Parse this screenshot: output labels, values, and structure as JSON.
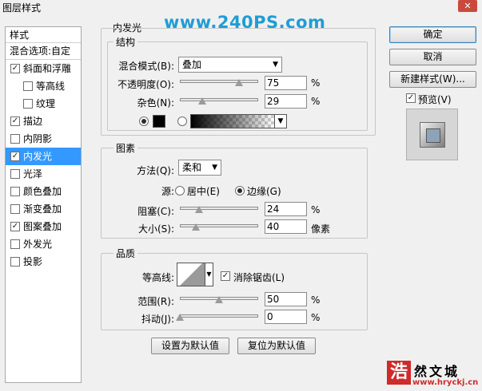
{
  "window": {
    "title": "图层样式",
    "close_glyph": "✕"
  },
  "watermark": "www.240PS.com",
  "style_list": {
    "header": "样式",
    "blend_options": "混合选项:自定",
    "items": [
      {
        "label": "斜面和浮雕",
        "checked": true,
        "indent": false,
        "selected": false
      },
      {
        "label": "等高线",
        "checked": false,
        "indent": true,
        "selected": false
      },
      {
        "label": "纹理",
        "checked": false,
        "indent": true,
        "selected": false
      },
      {
        "label": "描边",
        "checked": true,
        "indent": false,
        "selected": false
      },
      {
        "label": "内阴影",
        "checked": false,
        "indent": false,
        "selected": false
      },
      {
        "label": "内发光",
        "checked": true,
        "indent": false,
        "selected": true
      },
      {
        "label": "光泽",
        "checked": false,
        "indent": false,
        "selected": false
      },
      {
        "label": "颜色叠加",
        "checked": false,
        "indent": false,
        "selected": false
      },
      {
        "label": "渐变叠加",
        "checked": false,
        "indent": false,
        "selected": false
      },
      {
        "label": "图案叠加",
        "checked": true,
        "indent": false,
        "selected": false
      },
      {
        "label": "外发光",
        "checked": false,
        "indent": false,
        "selected": false
      },
      {
        "label": "投影",
        "checked": false,
        "indent": false,
        "selected": false
      }
    ]
  },
  "panel": {
    "title": "内发光",
    "structure": {
      "label": "结构",
      "blend_mode_label": "混合模式(B):",
      "blend_mode_value": "叠加",
      "opacity_label": "不透明度(O):",
      "opacity_value": "75",
      "opacity_unit": "%",
      "noise_label": "杂色(N):",
      "noise_value": "29",
      "noise_unit": "%",
      "glow_color": "#000000"
    },
    "elements": {
      "label": "图素",
      "method_label": "方法(Q):",
      "method_value": "柔和",
      "source_label": "源:",
      "source_center": "居中(E)",
      "source_edge": "边缘(G)",
      "choke_label": "阻塞(C):",
      "choke_value": "24",
      "choke_unit": "%",
      "size_label": "大小(S):",
      "size_value": "40",
      "size_unit": "像素"
    },
    "quality": {
      "label": "品质",
      "contour_label": "等高线:",
      "anti_alias_label": "消除锯齿(L)",
      "range_label": "范围(R):",
      "range_value": "50",
      "range_unit": "%",
      "jitter_label": "抖动(J):",
      "jitter_value": "0",
      "jitter_unit": "%"
    },
    "set_default": "设置为默认值",
    "reset_default": "复位为默认值"
  },
  "sliders": {
    "opacity": 0.75,
    "noise": 0.29,
    "choke": 0.24,
    "size": 0.2,
    "range": 0.5,
    "jitter": 0.0
  },
  "buttons": {
    "ok": "确定",
    "cancel": "取消",
    "new_style": "新建样式(W)...",
    "preview_label": "预览(V)"
  },
  "site_logo": {
    "mark": "浩",
    "brand": "然文城",
    "url": "www.hryckj.cn"
  }
}
